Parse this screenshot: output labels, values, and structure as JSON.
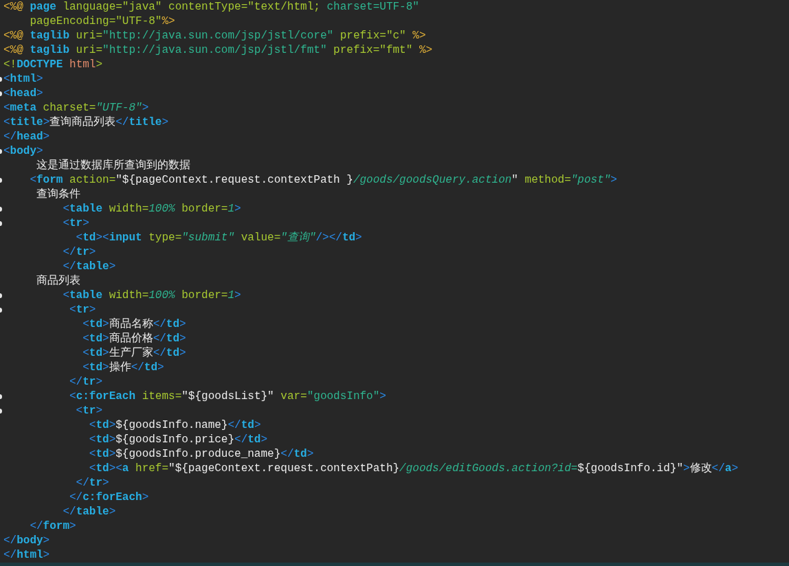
{
  "editor": {
    "lines": [
      {
        "fold": false,
        "tokens": [
          {
            "kind": "directive",
            "text": "<%@ "
          },
          {
            "kind": "tag",
            "text": "page"
          },
          {
            "kind": "attr",
            "text": " language=\"java\" contentType=\"text/html; "
          },
          {
            "kind": "string",
            "text": "charset=UTF-8\""
          }
        ]
      },
      {
        "fold": false,
        "tokens": [
          {
            "kind": "attr",
            "text": "    pageEncoding=\"UTF-8\""
          },
          {
            "kind": "directive",
            "text": "%>"
          }
        ]
      },
      {
        "fold": false,
        "tokens": [
          {
            "kind": "directive",
            "text": "<%@ "
          },
          {
            "kind": "tag",
            "text": "taglib"
          },
          {
            "kind": "attr",
            "text": " uri="
          },
          {
            "kind": "string",
            "text": "\"http://java.sun.com/jsp/jstl/core\""
          },
          {
            "kind": "attr",
            "text": " prefix=\"c\""
          },
          {
            "kind": "directive",
            "text": " %>"
          }
        ]
      },
      {
        "fold": false,
        "tokens": [
          {
            "kind": "directive",
            "text": "<%@ "
          },
          {
            "kind": "tag",
            "text": "taglib"
          },
          {
            "kind": "attr",
            "text": " uri="
          },
          {
            "kind": "string",
            "text": "\"http://java.sun.com/jsp/jstl/fmt\""
          },
          {
            "kind": "attr",
            "text": " prefix=\"fmt\""
          },
          {
            "kind": "directive",
            "text": " %>"
          }
        ]
      },
      {
        "fold": false,
        "tokens": [
          {
            "kind": "attr",
            "text": "<!"
          },
          {
            "kind": "tag",
            "text": "DOCTYPE"
          },
          {
            "kind": "doctype",
            "text": " html"
          },
          {
            "kind": "attr",
            "text": ">"
          }
        ]
      },
      {
        "fold": true,
        "tokens": [
          {
            "kind": "punct",
            "text": "<"
          },
          {
            "kind": "tag",
            "text": "html"
          },
          {
            "kind": "punct",
            "text": ">"
          }
        ]
      },
      {
        "fold": true,
        "tokens": [
          {
            "kind": "punct",
            "text": "<"
          },
          {
            "kind": "tag",
            "text": "head"
          },
          {
            "kind": "punct",
            "text": ">"
          }
        ]
      },
      {
        "fold": false,
        "tokens": [
          {
            "kind": "punct",
            "text": "<"
          },
          {
            "kind": "tag",
            "text": "meta"
          },
          {
            "kind": "attr",
            "text": " charset="
          },
          {
            "kind": "italic",
            "text": "\"UTF-8\""
          },
          {
            "kind": "punct",
            "text": ">"
          }
        ]
      },
      {
        "fold": false,
        "tokens": [
          {
            "kind": "punct",
            "text": "<"
          },
          {
            "kind": "tag",
            "text": "title"
          },
          {
            "kind": "punct",
            "text": ">"
          },
          {
            "kind": "text",
            "text": "查询商品列表"
          },
          {
            "kind": "punct",
            "text": "</"
          },
          {
            "kind": "tag",
            "text": "title"
          },
          {
            "kind": "punct",
            "text": ">"
          }
        ]
      },
      {
        "fold": false,
        "tokens": [
          {
            "kind": "punct",
            "text": "</"
          },
          {
            "kind": "tag",
            "text": "head"
          },
          {
            "kind": "punct",
            "text": ">"
          }
        ]
      },
      {
        "fold": true,
        "tokens": [
          {
            "kind": "punct",
            "text": "<"
          },
          {
            "kind": "tag",
            "text": "body"
          },
          {
            "kind": "punct",
            "text": ">"
          }
        ]
      },
      {
        "fold": false,
        "tokens": [
          {
            "kind": "text",
            "text": "     这是通过数据库所查询到的数据"
          }
        ]
      },
      {
        "fold": true,
        "tokens": [
          {
            "kind": "punct",
            "text": "    <"
          },
          {
            "kind": "tag",
            "text": "form"
          },
          {
            "kind": "attr",
            "text": " action="
          },
          {
            "kind": "text",
            "text": "\"${pageContext.request.contextPath }"
          },
          {
            "kind": "italic",
            "text": "/goods/goodsQuery.action"
          },
          {
            "kind": "text",
            "text": "\""
          },
          {
            "kind": "attr",
            "text": " method="
          },
          {
            "kind": "italic",
            "text": "\"post\""
          },
          {
            "kind": "punct",
            "text": ">"
          }
        ]
      },
      {
        "fold": false,
        "tokens": [
          {
            "kind": "text",
            "text": "     查询条件"
          }
        ]
      },
      {
        "fold": true,
        "tokens": [
          {
            "kind": "punct",
            "text": "         <"
          },
          {
            "kind": "tag",
            "text": "table"
          },
          {
            "kind": "attr",
            "text": " width="
          },
          {
            "kind": "italic",
            "text": "100%"
          },
          {
            "kind": "attr",
            "text": " border="
          },
          {
            "kind": "italic",
            "text": "1"
          },
          {
            "kind": "punct",
            "text": ">"
          }
        ]
      },
      {
        "fold": true,
        "tokens": [
          {
            "kind": "punct",
            "text": "         <"
          },
          {
            "kind": "tag",
            "text": "tr"
          },
          {
            "kind": "punct",
            "text": ">"
          }
        ]
      },
      {
        "fold": false,
        "tokens": [
          {
            "kind": "punct",
            "text": "           <"
          },
          {
            "kind": "tag",
            "text": "td"
          },
          {
            "kind": "punct",
            "text": "><"
          },
          {
            "kind": "tag",
            "text": "input"
          },
          {
            "kind": "attr",
            "text": " type="
          },
          {
            "kind": "italic",
            "text": "\"submit\""
          },
          {
            "kind": "attr",
            "text": " value="
          },
          {
            "kind": "italic",
            "text": "\"查询\""
          },
          {
            "kind": "punct",
            "text": "/></"
          },
          {
            "kind": "tag",
            "text": "td"
          },
          {
            "kind": "punct",
            "text": ">"
          }
        ]
      },
      {
        "fold": false,
        "tokens": [
          {
            "kind": "punct",
            "text": "         </"
          },
          {
            "kind": "tag",
            "text": "tr"
          },
          {
            "kind": "punct",
            "text": ">"
          }
        ]
      },
      {
        "fold": false,
        "tokens": [
          {
            "kind": "punct",
            "text": "         </"
          },
          {
            "kind": "tag",
            "text": "table"
          },
          {
            "kind": "punct",
            "text": ">"
          }
        ]
      },
      {
        "fold": false,
        "tokens": [
          {
            "kind": "text",
            "text": "     商品列表"
          }
        ]
      },
      {
        "fold": true,
        "tokens": [
          {
            "kind": "punct",
            "text": "         <"
          },
          {
            "kind": "tag",
            "text": "table"
          },
          {
            "kind": "attr",
            "text": " width="
          },
          {
            "kind": "italic",
            "text": "100%"
          },
          {
            "kind": "attr",
            "text": " border="
          },
          {
            "kind": "italic",
            "text": "1"
          },
          {
            "kind": "punct",
            "text": ">"
          }
        ]
      },
      {
        "fold": true,
        "tokens": [
          {
            "kind": "punct",
            "text": "          <"
          },
          {
            "kind": "tag",
            "text": "tr"
          },
          {
            "kind": "punct",
            "text": ">"
          }
        ]
      },
      {
        "fold": false,
        "tokens": [
          {
            "kind": "punct",
            "text": "            <"
          },
          {
            "kind": "tag",
            "text": "td"
          },
          {
            "kind": "punct",
            "text": ">"
          },
          {
            "kind": "text",
            "text": "商品名称"
          },
          {
            "kind": "punct",
            "text": "</"
          },
          {
            "kind": "tag",
            "text": "td"
          },
          {
            "kind": "punct",
            "text": ">"
          }
        ]
      },
      {
        "fold": false,
        "tokens": [
          {
            "kind": "punct",
            "text": "            <"
          },
          {
            "kind": "tag",
            "text": "td"
          },
          {
            "kind": "punct",
            "text": ">"
          },
          {
            "kind": "text",
            "text": "商品价格"
          },
          {
            "kind": "punct",
            "text": "</"
          },
          {
            "kind": "tag",
            "text": "td"
          },
          {
            "kind": "punct",
            "text": ">"
          }
        ]
      },
      {
        "fold": false,
        "tokens": [
          {
            "kind": "punct",
            "text": "            <"
          },
          {
            "kind": "tag",
            "text": "td"
          },
          {
            "kind": "punct",
            "text": ">"
          },
          {
            "kind": "text",
            "text": "生产厂家"
          },
          {
            "kind": "punct",
            "text": "</"
          },
          {
            "kind": "tag",
            "text": "td"
          },
          {
            "kind": "punct",
            "text": ">"
          }
        ]
      },
      {
        "fold": false,
        "tokens": [
          {
            "kind": "punct",
            "text": "            <"
          },
          {
            "kind": "tag",
            "text": "td"
          },
          {
            "kind": "punct",
            "text": ">"
          },
          {
            "kind": "text",
            "text": "操作"
          },
          {
            "kind": "punct",
            "text": "</"
          },
          {
            "kind": "tag",
            "text": "td"
          },
          {
            "kind": "punct",
            "text": ">"
          }
        ]
      },
      {
        "fold": false,
        "tokens": [
          {
            "kind": "punct",
            "text": "          </"
          },
          {
            "kind": "tag",
            "text": "tr"
          },
          {
            "kind": "punct",
            "text": ">"
          }
        ]
      },
      {
        "fold": true,
        "tokens": [
          {
            "kind": "punct",
            "text": "          <"
          },
          {
            "kind": "tag",
            "text": "c:forEach"
          },
          {
            "kind": "attr",
            "text": " items="
          },
          {
            "kind": "text",
            "text": "\"${goodsList}\""
          },
          {
            "kind": "attr",
            "text": " var="
          },
          {
            "kind": "string",
            "text": "\"goodsInfo\""
          },
          {
            "kind": "punct",
            "text": ">"
          }
        ]
      },
      {
        "fold": true,
        "tokens": [
          {
            "kind": "punct",
            "text": "           <"
          },
          {
            "kind": "tag",
            "text": "tr"
          },
          {
            "kind": "punct",
            "text": ">"
          }
        ]
      },
      {
        "fold": false,
        "tokens": [
          {
            "kind": "punct",
            "text": "             <"
          },
          {
            "kind": "tag",
            "text": "td"
          },
          {
            "kind": "punct",
            "text": ">"
          },
          {
            "kind": "text",
            "text": "${goodsInfo.name}"
          },
          {
            "kind": "punct",
            "text": "</"
          },
          {
            "kind": "tag",
            "text": "td"
          },
          {
            "kind": "punct",
            "text": ">"
          }
        ]
      },
      {
        "fold": false,
        "tokens": [
          {
            "kind": "punct",
            "text": "             <"
          },
          {
            "kind": "tag",
            "text": "td"
          },
          {
            "kind": "punct",
            "text": ">"
          },
          {
            "kind": "text",
            "text": "${goodsInfo.price}"
          },
          {
            "kind": "punct",
            "text": "</"
          },
          {
            "kind": "tag",
            "text": "td"
          },
          {
            "kind": "punct",
            "text": ">"
          }
        ]
      },
      {
        "fold": false,
        "tokens": [
          {
            "kind": "punct",
            "text": "             <"
          },
          {
            "kind": "tag",
            "text": "td"
          },
          {
            "kind": "punct",
            "text": ">"
          },
          {
            "kind": "text",
            "text": "${goodsInfo.produce_name}"
          },
          {
            "kind": "punct",
            "text": "</"
          },
          {
            "kind": "tag",
            "text": "td"
          },
          {
            "kind": "punct",
            "text": ">"
          }
        ]
      },
      {
        "fold": false,
        "tokens": [
          {
            "kind": "punct",
            "text": "             <"
          },
          {
            "kind": "tag",
            "text": "td"
          },
          {
            "kind": "punct",
            "text": "><"
          },
          {
            "kind": "tag",
            "text": "a"
          },
          {
            "kind": "attr",
            "text": " href="
          },
          {
            "kind": "text",
            "text": "\"${pageContext.request.contextPath}"
          },
          {
            "kind": "italic",
            "text": "/goods/editGoods.action?id="
          },
          {
            "kind": "text",
            "text": "${goodsInfo.id}\""
          },
          {
            "kind": "punct",
            "text": ">"
          },
          {
            "kind": "text",
            "text": "修改"
          },
          {
            "kind": "punct",
            "text": "</"
          },
          {
            "kind": "tag",
            "text": "a"
          },
          {
            "kind": "punct",
            "text": ">"
          }
        ]
      },
      {
        "fold": false,
        "tokens": [
          {
            "kind": "punct",
            "text": "           </"
          },
          {
            "kind": "tag",
            "text": "tr"
          },
          {
            "kind": "punct",
            "text": ">"
          }
        ]
      },
      {
        "fold": false,
        "tokens": [
          {
            "kind": "punct",
            "text": "          </"
          },
          {
            "kind": "tag",
            "text": "c:forEach"
          },
          {
            "kind": "punct",
            "text": ">"
          }
        ]
      },
      {
        "fold": false,
        "tokens": [
          {
            "kind": "punct",
            "text": "         </"
          },
          {
            "kind": "tag",
            "text": "table"
          },
          {
            "kind": "punct",
            "text": ">"
          }
        ]
      },
      {
        "fold": false,
        "tokens": [
          {
            "kind": "punct",
            "text": "    </"
          },
          {
            "kind": "tag",
            "text": "form"
          },
          {
            "kind": "punct",
            "text": ">"
          }
        ]
      },
      {
        "fold": false,
        "tokens": [
          {
            "kind": "punct",
            "text": "</"
          },
          {
            "kind": "tag",
            "text": "body"
          },
          {
            "kind": "punct",
            "text": ">"
          }
        ]
      },
      {
        "fold": false,
        "tokens": [
          {
            "kind": "punct",
            "text": "</"
          },
          {
            "kind": "tag",
            "text": "html"
          },
          {
            "kind": "punct",
            "text": ">"
          }
        ]
      }
    ]
  }
}
